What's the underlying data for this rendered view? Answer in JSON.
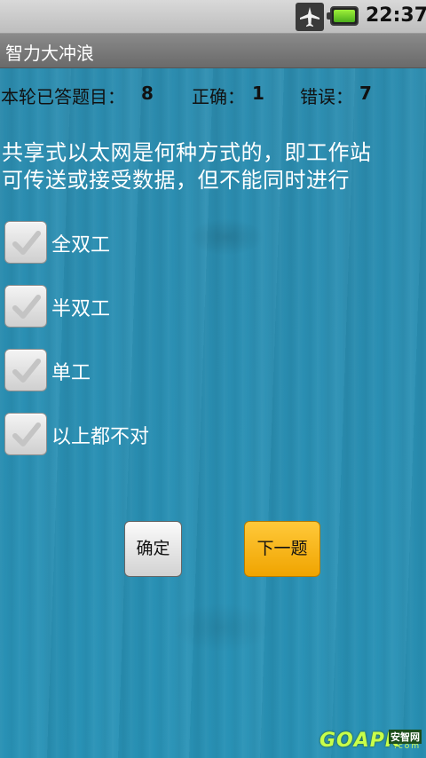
{
  "statusbar": {
    "time": "22:37",
    "icons": [
      "airplane-mode-icon",
      "battery-icon"
    ]
  },
  "app": {
    "title": "智力大冲浪"
  },
  "stats": {
    "answered_label": "本轮已答题目：",
    "answered_value": "8",
    "correct_label": "正确：",
    "correct_value": "1",
    "wrong_label": "错误：",
    "wrong_value": "7"
  },
  "question": {
    "line1": "共享式以太网是何种方式的，即工作站",
    "line2": "可传送或接受数据，但不能同时进行"
  },
  "options": [
    {
      "label": "全双工",
      "checked": false
    },
    {
      "label": "半双工",
      "checked": false
    },
    {
      "label": "单工",
      "checked": false
    },
    {
      "label": "以上都不对",
      "checked": false
    }
  ],
  "buttons": {
    "confirm": "确定",
    "next": "下一题"
  },
  "watermark": {
    "brand": "GOAPK",
    "cn": "安智网",
    "domain": ".com"
  },
  "colors": {
    "content_bg": "#2a8fb3",
    "next_button": "#f7b400",
    "title_bar": "#7a7a7a"
  }
}
